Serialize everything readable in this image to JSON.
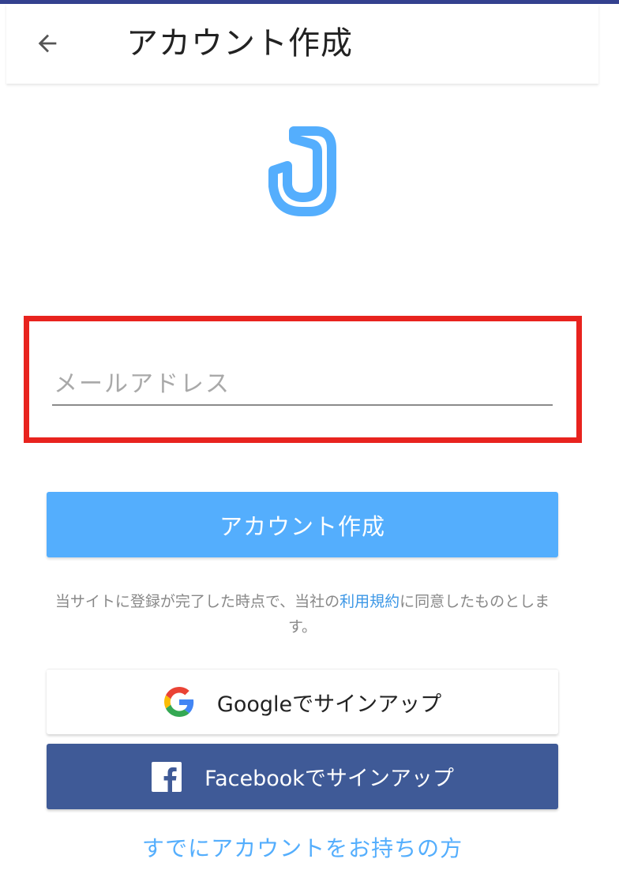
{
  "header": {
    "title": "アカウント作成",
    "back_icon": "arrow-left-icon"
  },
  "logo": {
    "icon": "app-logo",
    "color": "#54aefd"
  },
  "form": {
    "email_placeholder": "メールアドレス",
    "email_value": ""
  },
  "create_button": {
    "label": "アカウント作成",
    "color": "#54aefd"
  },
  "terms": {
    "text_before": "当サイトに登録が完了した時点で、当社の",
    "link_text": "利用規約",
    "text_after": "に同意したものとします。"
  },
  "google_button": {
    "label": "Googleでサインアップ",
    "icon": "google-icon"
  },
  "facebook_button": {
    "label": "Facebookでサインアップ",
    "icon": "facebook-icon",
    "color": "#3f5a97"
  },
  "existing_account_link": "すでにアカウントをお持ちの方",
  "colors": {
    "accent": "#54aefd",
    "highlight": "#e8231e",
    "status_strip": "#34418f"
  }
}
